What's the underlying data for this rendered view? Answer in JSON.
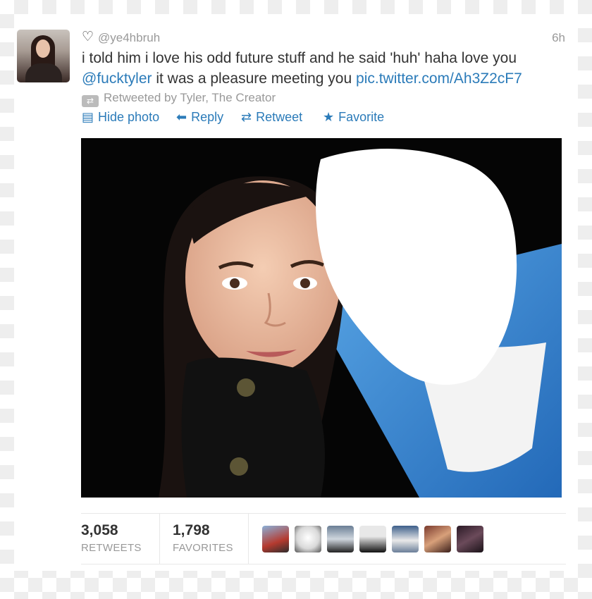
{
  "tweet": {
    "handle": "@ye4hbruh",
    "time": "6h",
    "text_part1": "i told him i love his odd future stuff and he said 'huh' haha love you",
    "mention": "@fucktyler",
    "text_part2": " it was a pleasure meeting you ",
    "link": "pic.twitter.com/Ah3Z2cF7",
    "retweeted_by": "Retweeted by Tyler, The Creator"
  },
  "actions": {
    "hide_photo": "Hide photo",
    "reply": "Reply",
    "retweet": "Retweet",
    "favorite": "Favorite"
  },
  "stats": {
    "retweets_count": "3,058",
    "retweets_label": "RETWEETS",
    "favorites_count": "1,798",
    "favorites_label": "FAVORITES"
  },
  "icons": {
    "heart": "heart-icon",
    "retweeted": "retweet-icon",
    "hide_photo": "photo-icon",
    "reply": "reply-arrow-icon",
    "retweet": "retweet-icon",
    "favorite": "star-icon"
  },
  "colors": {
    "link": "#2b7bb9",
    "text": "#333333",
    "muted": "#999999",
    "jacket": "#3a8fd8"
  }
}
